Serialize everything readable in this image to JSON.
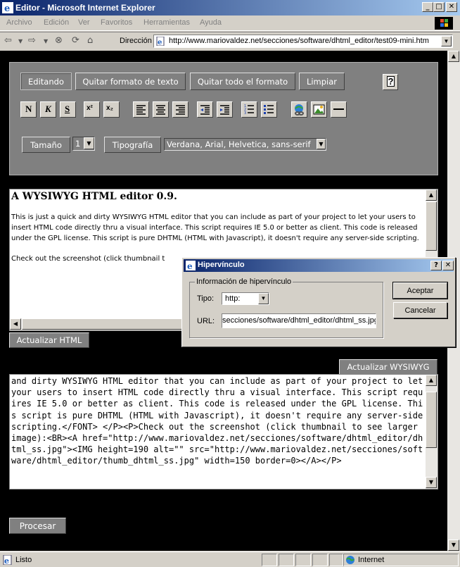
{
  "window": {
    "title": "Editor - Microsoft Internet Explorer",
    "minimize_icon": "_",
    "maximize_icon": "□",
    "close_icon": "✕"
  },
  "menu": {
    "items": [
      "Archivo",
      "Edición",
      "Ver",
      "Favoritos",
      "Herramientas",
      "Ayuda"
    ]
  },
  "address": {
    "label": "Dirección",
    "url": "http://www.mariovaldez.net/secciones/software/dhtml_editor/test09-mini.htm"
  },
  "toolbar": {
    "mode_buttons": [
      "Editando",
      "Quitar formato de texto",
      "Quitar todo el formato",
      "Limpiar"
    ],
    "help_label": "?",
    "format_icons": [
      {
        "name": "bold-icon",
        "glyph": "N"
      },
      {
        "name": "italic-icon",
        "glyph": "K"
      },
      {
        "name": "underline-icon",
        "glyph": "S"
      },
      {
        "name": "superscript-icon",
        "glyph": "x²"
      },
      {
        "name": "subscript-icon",
        "glyph": "x₂"
      }
    ],
    "size_label": "Tamaño",
    "size_value": "1",
    "font_label": "Tipografía",
    "font_value": "Verdana, Arial, Helvetica, sans-serif"
  },
  "wysiwyg": {
    "title": "A WYSIWYG HTML editor 0.9.",
    "paragraph": "This is just a quick and dirty WYSIWYG HTML editor that you can include as part of your project to let your users to insert HTML code directly thru a visual interface. This script requires IE 5.0 or better as client. This code is released under the GPL license. This script is pure DHTML (HTML with Javascript), it doesn't require any server-side scripting.",
    "paragraph2": "Check out the screenshot (click thumbnail t"
  },
  "buttons": {
    "update_html": "Actualizar HTML",
    "update_wysiwyg": "Actualizar WYSIWYG",
    "process": "Procesar"
  },
  "source_html": "and dirty WYSIWYG HTML editor that you can include as part of your project to let your users to insert HTML code directly thru a visual interface. This script requires IE 5.0 or better as client. This code is released under the GPL license. This script is pure DHTML (HTML with Javascript), it doesn't require any server-side scripting.</FONT> </P><P>Check out the screenshot (click thumbnail to see larger image):<BR><A href=\"http://www.mariovaldez.net/secciones/software/dhtml_editor/dhtml_ss.jpg\"><IMG height=190 alt=\"\" src=\"http://www.mariovaldez.net/secciones/software/dhtml_editor/thumb_dhtml_ss.jpg\" width=150 border=0></A></P>",
  "dialog": {
    "title": "Hipervínculo",
    "help": "?",
    "close": "✕",
    "group_label": "Información de hipervínculo",
    "type_label": "Tipo:",
    "type_value": "http:",
    "url_label": "URL:",
    "url_value": "secciones/software/dhtml_editor/dhtml_ss.jpg",
    "ok": "Aceptar",
    "cancel": "Cancelar"
  },
  "status": {
    "text": "Listo",
    "zone": "Internet"
  },
  "colors": {
    "titlebar_start": "#0a246a",
    "titlebar_end": "#a6caf0",
    "panel": "#808080",
    "page_bg": "#000000"
  }
}
